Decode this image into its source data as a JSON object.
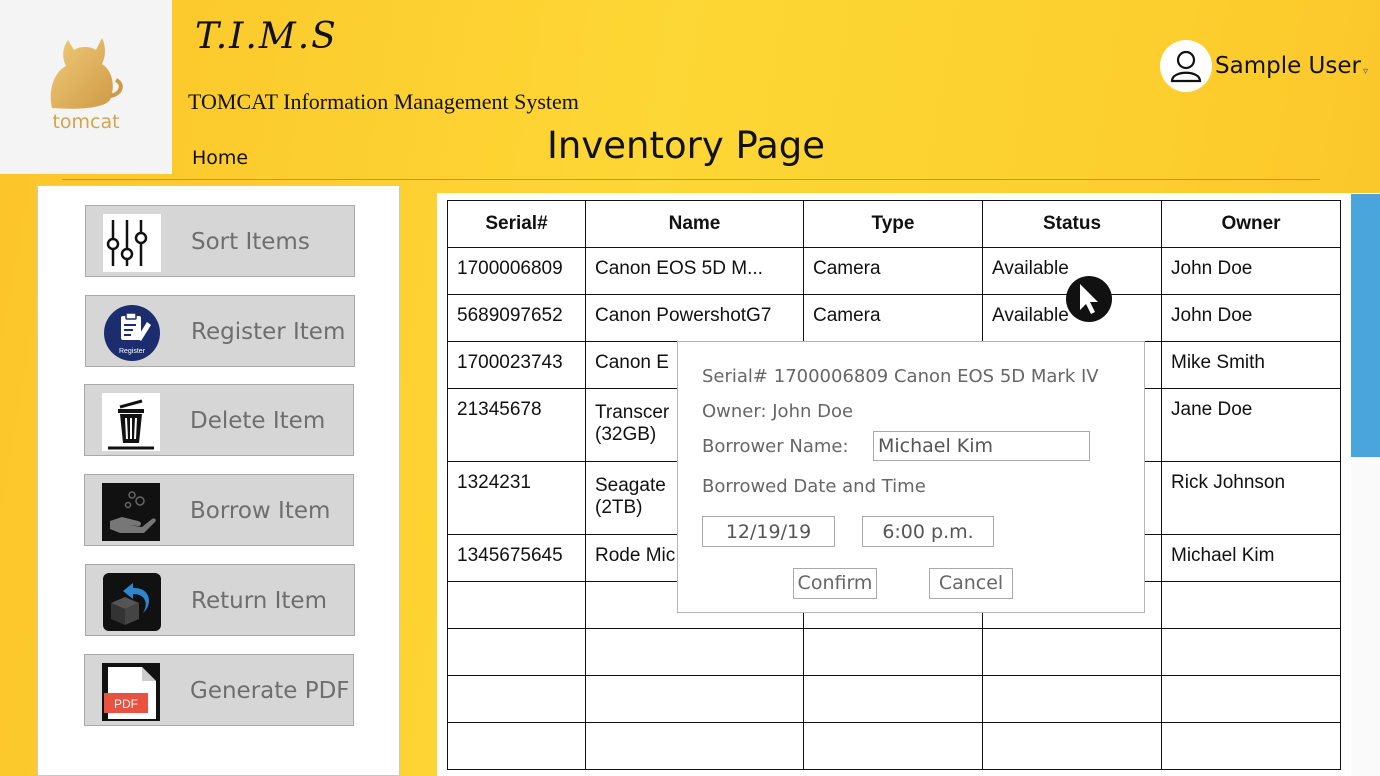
{
  "logo": {
    "text": "tomcat"
  },
  "header": {
    "app_title": "T.I.M.S",
    "app_subtitle": "TOMCAT Information Management System",
    "home_link": "Home",
    "page_title": "Inventory Page",
    "user_name": "Sample User",
    "user_caret": "▿"
  },
  "sidebar": {
    "items": [
      {
        "label": "Sort Items",
        "icon": "sliders-icon"
      },
      {
        "label": "Register Item",
        "icon": "clipboard-register-icon",
        "icon_caption": "Register"
      },
      {
        "label": "Delete Item",
        "icon": "trash-icon"
      },
      {
        "label": "Borrow Item",
        "icon": "hand-coins-icon"
      },
      {
        "label": "Return Item",
        "icon": "return-box-icon"
      },
      {
        "label": "Generate PDF",
        "icon": "pdf-icon",
        "icon_caption": "PDF"
      }
    ]
  },
  "table": {
    "headers": [
      "Serial#",
      "Name",
      "Type",
      "Status",
      "Owner"
    ],
    "rows": [
      [
        "1700006809",
        "Canon EOS 5D M...",
        "Camera",
        "Available",
        "John Doe"
      ],
      [
        "5689097652",
        "Canon PowershotG7",
        "Camera",
        "Available",
        "John Doe"
      ],
      [
        "1700023743",
        "Canon E",
        "",
        "",
        "Mike Smith"
      ],
      [
        "21345678",
        "Transcer\n(32GB)",
        "",
        "",
        "Jane Doe"
      ],
      [
        "1324231",
        "Seagate\n(2TB)",
        "",
        "",
        "Rick Johnson"
      ],
      [
        "1345675645",
        "Rode Mic",
        "",
        "",
        "Michael Kim"
      ],
      [
        "",
        "",
        "",
        "",
        ""
      ],
      [
        "",
        "",
        "",
        "",
        ""
      ],
      [
        "",
        "",
        "",
        "",
        ""
      ],
      [
        "",
        "",
        "",
        "",
        ""
      ]
    ]
  },
  "dialog": {
    "title": "Serial# 1700006809 Canon EOS 5D Mark IV",
    "owner": "Owner: John Doe",
    "borrower_label": "Borrower Name:",
    "borrower_value": "Michael Kim",
    "datetime_label": "Borrowed Date and Time",
    "date_value": "12/19/19",
    "time_value": "6:00 p.m.",
    "confirm_label": "Confirm",
    "cancel_label": "Cancel"
  },
  "colors": {
    "background": "#fdd735",
    "scroll_thumb": "#4aa5dd",
    "logo_gold": "#d4a44a",
    "pdf_red": "#e8523f"
  }
}
